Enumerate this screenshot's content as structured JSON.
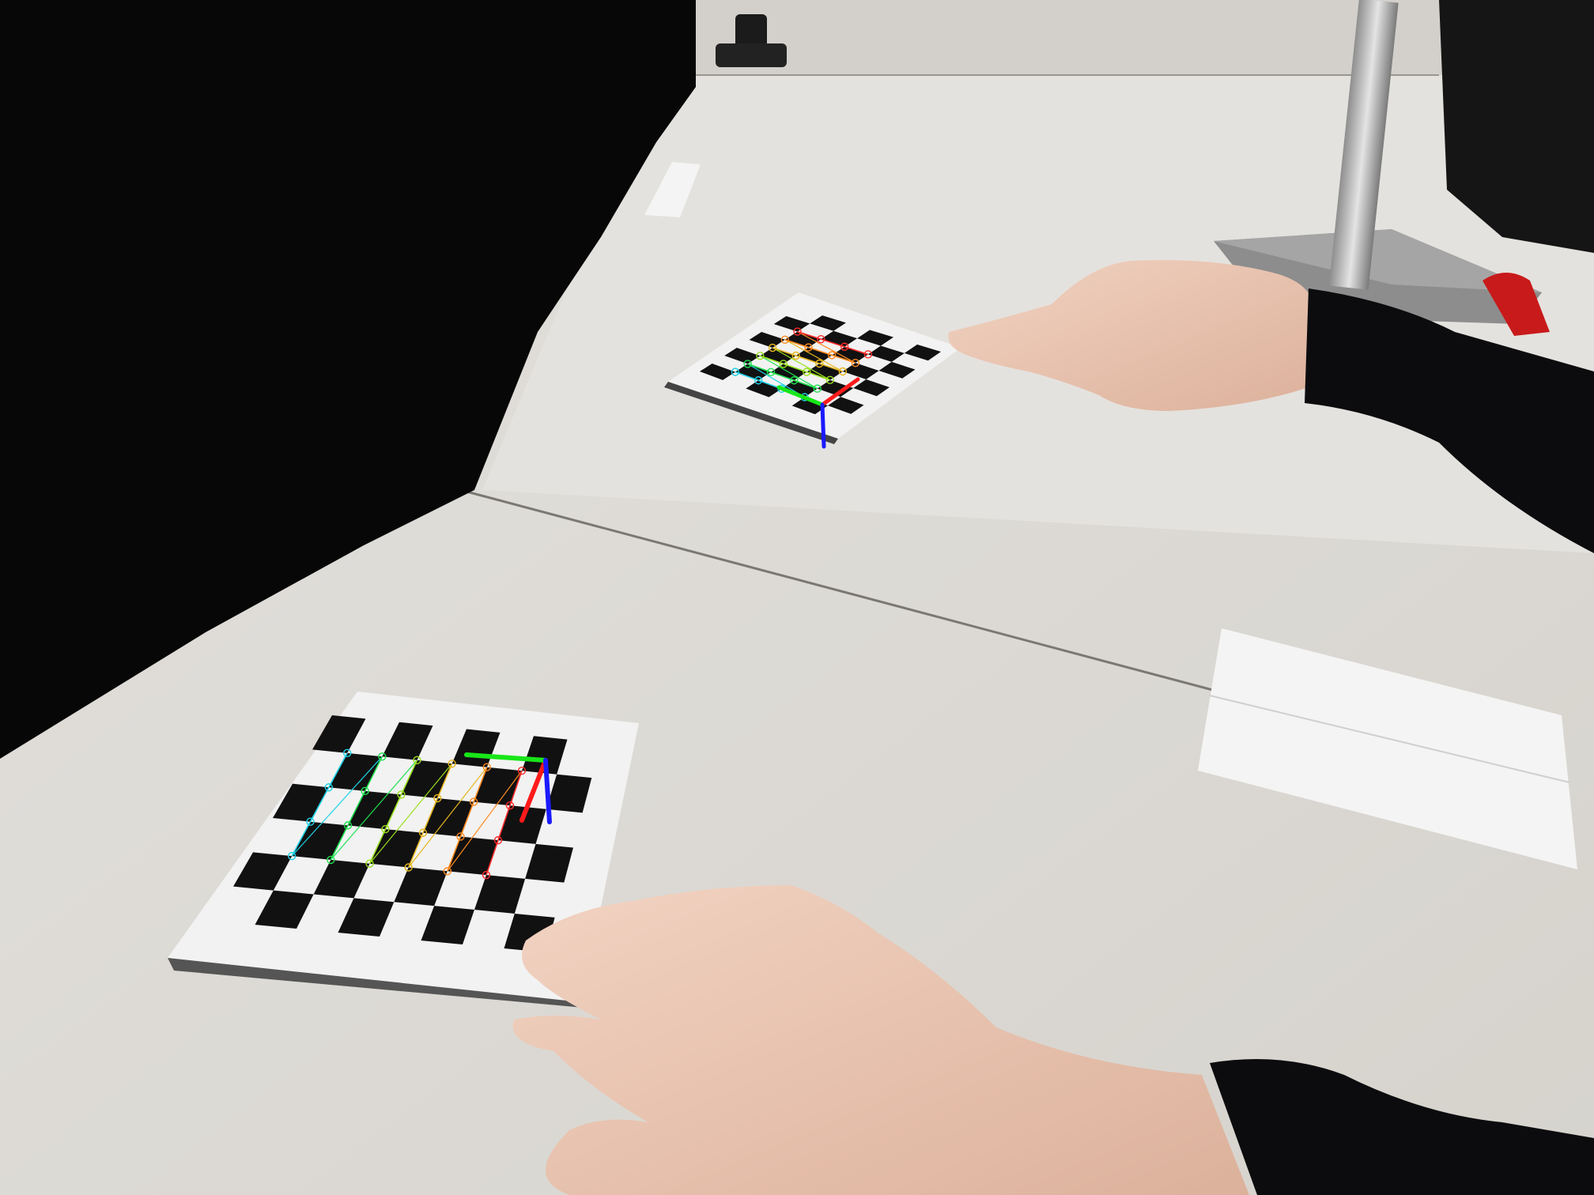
{
  "scene": {
    "description_free": true,
    "colors": {
      "table": "#dddad5",
      "table_far": "#e2e0dc",
      "black_cloth": "#070707",
      "skin": "#ecc9b6",
      "sleeve": "#0c0c0e",
      "paper": "#f1f1f1",
      "square": "#111111",
      "axis_x": "#ff1a1a",
      "axis_y": "#18e618",
      "axis_z": "#1a1aff"
    },
    "detection_colors": [
      "#1fd2e6",
      "#20e050",
      "#9ae01e",
      "#e6b61e",
      "#ff8a1e",
      "#ff2a2a"
    ],
    "boards": [
      {
        "id": "near-board",
        "grid_cols": 6,
        "grid_rows": 4
      },
      {
        "id": "far-board",
        "grid_cols": 6,
        "grid_rows": 4
      }
    ]
  }
}
